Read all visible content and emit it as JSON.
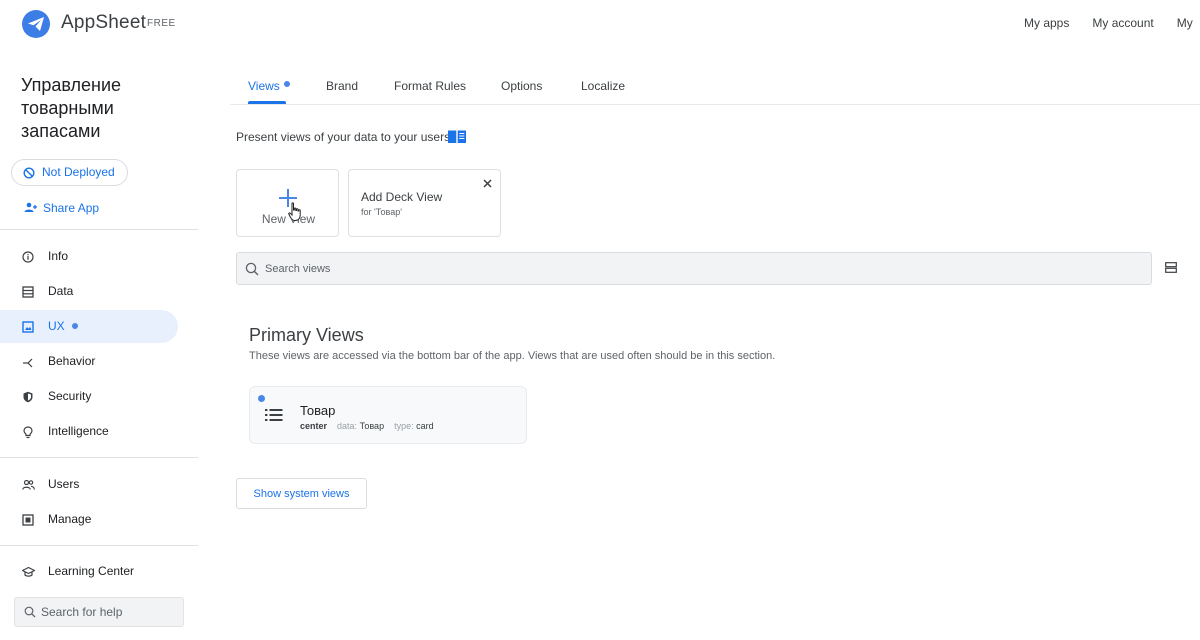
{
  "header": {
    "brand": "AppSheet",
    "plan": "FREE",
    "links": [
      "My apps",
      "My account",
      "My"
    ]
  },
  "sidebar": {
    "app_title": "Управление товарными запасами",
    "deploy_status": "Not Deployed",
    "share_label": "Share App",
    "nav": [
      {
        "label": "Info",
        "icon": "info-icon"
      },
      {
        "label": "Data",
        "icon": "data-icon"
      },
      {
        "label": "UX",
        "icon": "ux-icon",
        "active": true
      },
      {
        "label": "Behavior",
        "icon": "behavior-icon"
      },
      {
        "label": "Security",
        "icon": "shield-icon"
      },
      {
        "label": "Intelligence",
        "icon": "lightbulb-icon"
      }
    ],
    "nav2": [
      {
        "label": "Users",
        "icon": "users-icon"
      },
      {
        "label": "Manage",
        "icon": "manage-icon"
      }
    ],
    "learning": "Learning Center",
    "help_placeholder": "Search for help"
  },
  "tabs": [
    {
      "label": "Views",
      "active": true
    },
    {
      "label": "Brand"
    },
    {
      "label": "Format Rules"
    },
    {
      "label": "Options"
    },
    {
      "label": "Localize"
    }
  ],
  "main": {
    "description": "Present views of your data to your users.",
    "new_view_label": "New View",
    "suggestion": {
      "title": "Add Deck View",
      "subtitle": "for 'Товар'"
    },
    "search_placeholder": "Search views",
    "section_title": "Primary Views",
    "section_desc": "These views are accessed via the bottom bar of the app. Views that are used often should be in this section.",
    "view": {
      "name": "Товар",
      "position": "center",
      "data_label": "data:",
      "data_value": "Товар",
      "type_label": "type:",
      "type_value": "card"
    },
    "system_views_button": "Show system views"
  },
  "colors": {
    "accent": "#1a73e8",
    "brand_logo": "#3d7ee6",
    "active_nav_bg": "#e8f0fe"
  }
}
